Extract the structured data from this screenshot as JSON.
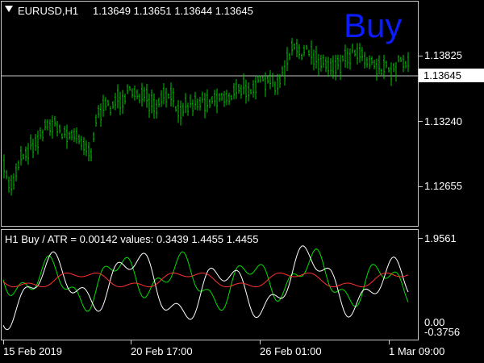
{
  "chart": {
    "symbol_timeframe": "EURUSD,H1",
    "ohlc": "1.13649 1.13651 1.13644 1.13645",
    "signal": "Buy",
    "price_axis": [
      "1.13825",
      "1.13240",
      "1.12655"
    ],
    "current_price": "1.13645"
  },
  "indicator": {
    "header": "H1 Buy  /  ATR = 0.00142    values: 0.3439 1.4455 1.4455",
    "axis": [
      "1.9561",
      "0.00",
      "-0.3756"
    ]
  },
  "time_axis": [
    "15 Feb 2019",
    "20 Feb 17:00",
    "26 Feb 01:00",
    "1 Mar 09:00"
  ],
  "colors": {
    "background": "#000000",
    "candles": "#00c800",
    "signal": "#0b1cff",
    "grid": "#c8c8c8",
    "line_green": "#00e000",
    "line_white": "#ffffff",
    "line_red": "#ff3030"
  },
  "icons": {
    "symbol_dropdown": "triangle-down-icon"
  }
}
